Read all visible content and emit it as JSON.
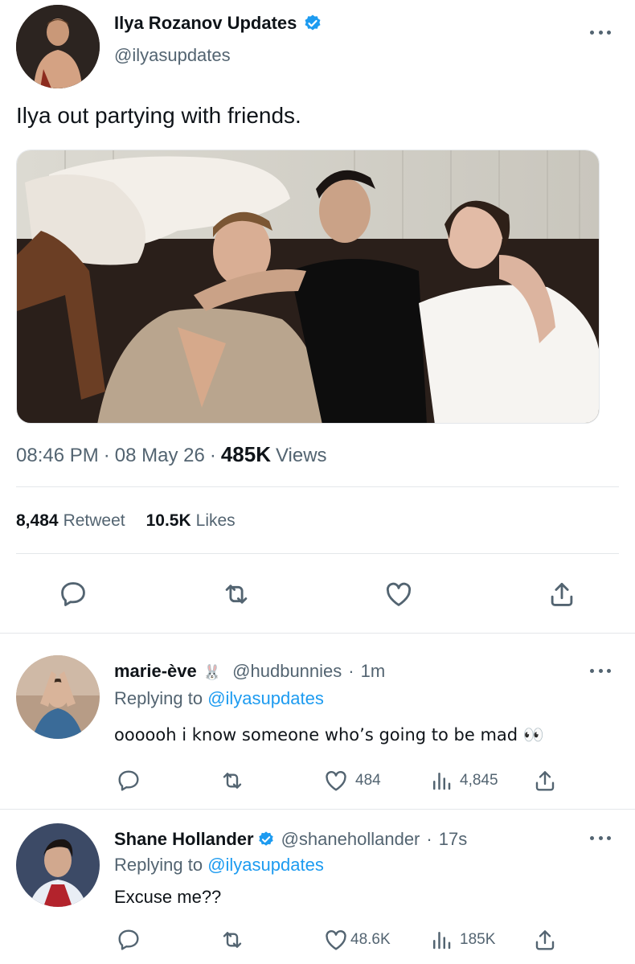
{
  "main_tweet": {
    "author_name": "Ilya Rozanov Updates",
    "handle": "@ilyasupdates",
    "verified": true,
    "text": "Ilya out partying with friends.",
    "time": "08:46 PM",
    "date": "08 May 26",
    "views_count": "485K",
    "views_label": "Views",
    "retweets_count": "8,484",
    "retweets_label": "Retweet",
    "likes_count": "10.5K",
    "likes_label": "Likes",
    "actions": [
      "reply-icon",
      "retweet-icon",
      "like-icon",
      "share-icon"
    ]
  },
  "replies": [
    {
      "author_name": "marie-ève",
      "name_emoji": "🐰",
      "handle": "@hudbunnies",
      "time": "1m",
      "verified": false,
      "replying_label": "Replying to",
      "replying_to": "@ilyasupdates",
      "text": "oooooh i know someone who’s going to be mad 👀",
      "likes": "484",
      "views": "4,845"
    },
    {
      "author_name": "Shane Hollander",
      "name_emoji": "",
      "handle": "@shanehollander",
      "time": "17s",
      "verified": true,
      "replying_label": "Replying to",
      "replying_to": "@ilyasupdates",
      "text": "Excuse me??",
      "likes": "48.6K",
      "views": "185K"
    }
  ],
  "separator": "·",
  "colors": {
    "accent": "#1d9bf0",
    "text": "#0f1419",
    "muted": "#536471",
    "divider": "#e4e7ea"
  }
}
